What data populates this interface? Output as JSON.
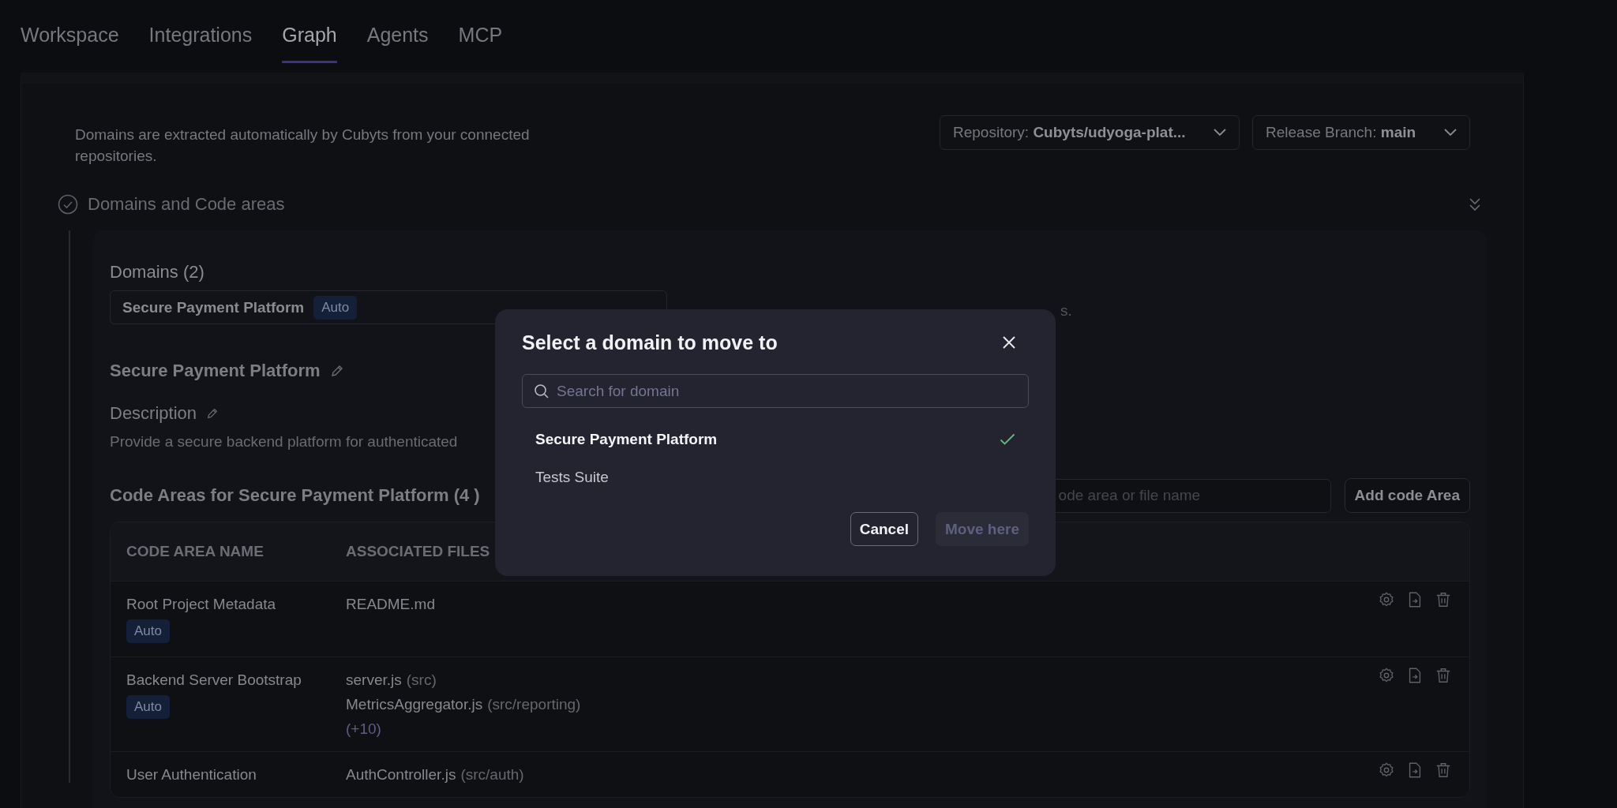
{
  "tabs": [
    {
      "label": "Workspace",
      "selected": false
    },
    {
      "label": "Integrations",
      "selected": false
    },
    {
      "label": "Graph",
      "selected": true
    },
    {
      "label": "Agents",
      "selected": false
    },
    {
      "label": "MCP",
      "selected": false
    }
  ],
  "intro": "Domains are extracted automatically by Cubyts from your connected repositories.",
  "filters": [
    {
      "label": "Repository:",
      "value": "Cubyts/udyoga-plat..."
    },
    {
      "label": "Release Branch:",
      "value": "main"
    }
  ],
  "section": {
    "title": "Domains and Code areas"
  },
  "domains": {
    "heading": "Domains (2)",
    "selected": "Secure Payment Platform",
    "badge": "Auto",
    "hint_fragment": "s."
  },
  "domain_title": "Secure Payment Platform",
  "description": {
    "label": "Description",
    "text": "Provide a secure backend platform for authenticated"
  },
  "code_areas": {
    "heading": "Code Areas for Secure Payment Platform (4 )",
    "search_placeholder": "ode area or file name",
    "add_button": "Add code Area"
  },
  "table": {
    "columns": [
      "CODE AREA NAME",
      "ASSOCIATED FILES"
    ],
    "rows": [
      {
        "name": "Root Project Metadata",
        "badge": "Auto",
        "files": [
          {
            "name": "README.md"
          }
        ]
      },
      {
        "name": "Backend Server Bootstrap",
        "badge": "Auto",
        "files": [
          {
            "name": "server.js",
            "path": "(src)"
          },
          {
            "name": "MetricsAggregator.js",
            "path": "(src/reporting)"
          }
        ],
        "more": "(+10)"
      },
      {
        "name": "User Authentication",
        "files": [
          {
            "name": "AuthController.js",
            "path": "(src/auth)"
          }
        ]
      }
    ]
  },
  "modal": {
    "title": "Select a domain to move to",
    "search_placeholder": "Search for domain",
    "options": [
      {
        "label": "Secure Payment Platform",
        "selected": true
      },
      {
        "label": "Tests Suite",
        "selected": false
      }
    ],
    "cancel": "Cancel",
    "confirm": {
      "label": "Move here",
      "disabled": true
    }
  }
}
